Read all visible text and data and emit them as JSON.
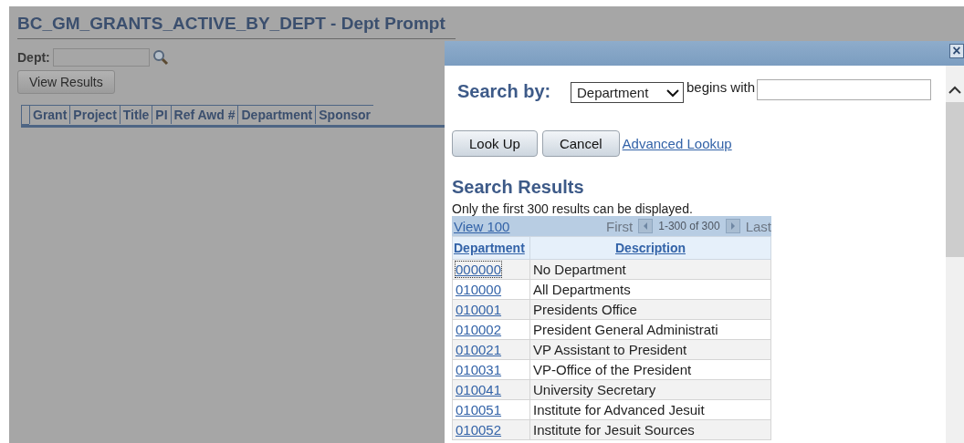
{
  "page": {
    "title": "BC_GM_GRANTS_ACTIVE_BY_DEPT - Dept Prompt",
    "dept_label": "Dept:",
    "view_button": "View Results",
    "columns": [
      "Grant",
      "Project",
      "Title",
      "PI",
      "Ref Awd #",
      "Department",
      "Sponsor"
    ]
  },
  "dialog": {
    "close": "×",
    "search_by_label": "Search by:",
    "search_field": "Department",
    "operator": "begins with",
    "buttons": [
      "Look Up",
      "Cancel"
    ],
    "advanced_link": "Advanced Lookup",
    "results_title": "Search Results",
    "note": "Only the first 300 results can be displayed.",
    "nav": {
      "view_link": "View 100",
      "first": "First",
      "range": "1-300 of 300",
      "last": "Last"
    },
    "columns": [
      "Department",
      "Description"
    ],
    "rows": [
      {
        "code": "000000",
        "description": "No Department",
        "focused": true
      },
      {
        "code": "010000",
        "description": "All Departments",
        "focused": false
      },
      {
        "code": "010001",
        "description": "Presidents Office",
        "focused": false
      },
      {
        "code": "010002",
        "description": "President General Administrati",
        "focused": false
      },
      {
        "code": "010021",
        "description": "VP Assistant to President",
        "focused": false
      },
      {
        "code": "010031",
        "description": "VP-Office of the President",
        "focused": false
      },
      {
        "code": "010041",
        "description": "University Secretary",
        "focused": false
      },
      {
        "code": "010051",
        "description": "Institute for Advanced Jesuit",
        "focused": false
      },
      {
        "code": "010052",
        "description": "Institute for Jesuit Sources",
        "focused": false
      }
    ]
  }
}
